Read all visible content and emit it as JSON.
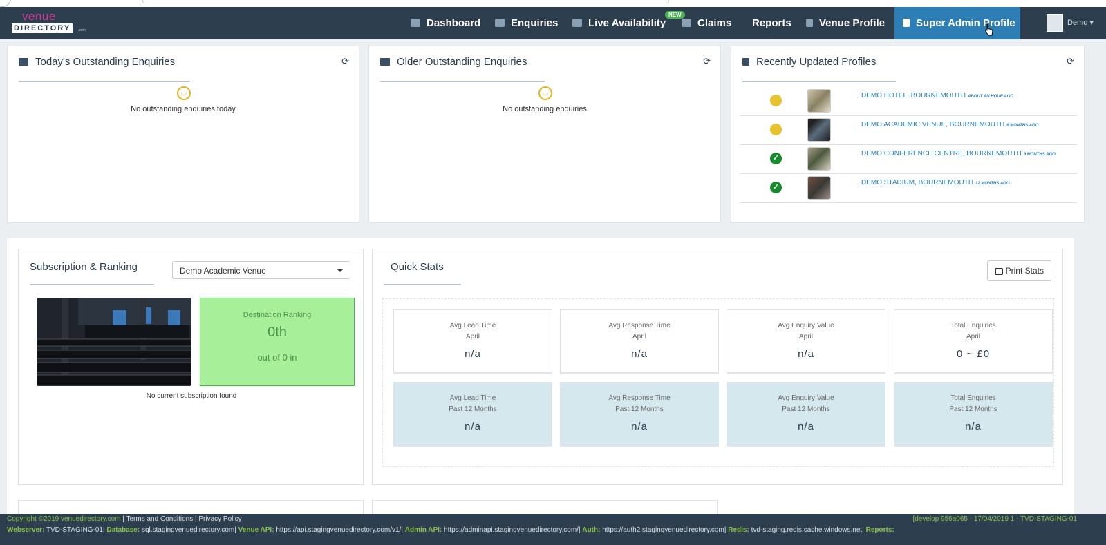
{
  "nav": {
    "logo_top": "venue",
    "logo_bottom": "DIRECTORY",
    "logo_com": ".com",
    "items": [
      {
        "label": "Dashboard",
        "icon": "dashboard-icon"
      },
      {
        "label": "Enquiries",
        "icon": "envelope-icon"
      },
      {
        "label": "Live Availability",
        "icon": "calendar-icon",
        "badge": "NEW"
      },
      {
        "label": "Claims",
        "icon": "book-icon"
      },
      {
        "label": "Reports",
        "icon": ""
      },
      {
        "label": "Venue Profile",
        "icon": "building-icon"
      },
      {
        "label": "Super Admin Profile",
        "icon": "lock-icon"
      }
    ],
    "user": "Demo",
    "user_caret": "▾"
  },
  "todays": {
    "title": "Today's Outstanding Enquiries",
    "empty": "No outstanding enquiries today"
  },
  "older": {
    "title": "Older Outstanding Enquiries",
    "empty": "No outstanding enquiries"
  },
  "recent": {
    "title": "Recently Updated Profiles",
    "profiles": [
      {
        "name": "DEMO HOTEL, BOURNEMOUTH",
        "time": "ABOUT AN HOUR AGO",
        "status": "pending"
      },
      {
        "name": "DEMO ACADEMIC VENUE, BOURNEMOUTH",
        "time": "6 MONTHS AGO",
        "status": "pending"
      },
      {
        "name": "DEMO CONFERENCE CENTRE, BOURNEMOUTH",
        "time": "9 MONTHS AGO",
        "status": "ok"
      },
      {
        "name": "DEMO STADIUM, BOURNEMOUTH",
        "time": "12 MONTHS AGO",
        "status": "ok"
      }
    ]
  },
  "subscription": {
    "title": "Subscription & Ranking",
    "selected_venue": "Demo Academic Venue",
    "rank_title": "Destination Ranking",
    "rank_value": "0th",
    "rank_sub": "out of 0 in",
    "no_sub": "No current subscription found"
  },
  "quick_stats": {
    "title": "Quick Stats",
    "print_label": "Print Stats",
    "cards": [
      {
        "label": "Avg Lead Time",
        "period": "April",
        "value": "n/a"
      },
      {
        "label": "Avg Response Time",
        "period": "April",
        "value": "n/a"
      },
      {
        "label": "Avg Enquiry Value",
        "period": "April",
        "value": "n/a"
      },
      {
        "label": "Total Enquiries",
        "period": "April",
        "value": "0 ~ £0"
      },
      {
        "label": "Avg Lead Time",
        "period": "Past 12 Months",
        "value": "n/a"
      },
      {
        "label": "Avg Response Time",
        "period": "Past 12 Months",
        "value": "n/a"
      },
      {
        "label": "Avg Enquiry Value",
        "period": "Past 12 Months",
        "value": "n/a"
      },
      {
        "label": "Total Enquiries",
        "period": "Past 12 Months",
        "value": "n/a"
      }
    ]
  },
  "footer": {
    "copyright": "Copyright ©2019 venuedirectory.com",
    "terms": "Terms and Conditions",
    "privacy": "Privacy Policy",
    "build": "[develop 956a065 - 17/04/2019 1 - TVD-STAGING-01",
    "webserver_label": "Webserver:",
    "webserver": "TVD-STAGING-01",
    "database_label": "Database:",
    "database": "sql.stagingvenuedirectory.com",
    "venue_api_label": "Venue API:",
    "venue_api": "https://api.stagingvenuedirectory.com/v1/",
    "admin_api_label": "Admin API:",
    "admin_api": "https://adminapi.stagingvenuedirectory.com/",
    "auth_label": "Auth:",
    "auth": "https://auth2.stagingvenuedirectory.com",
    "redis_label": "Redis:",
    "redis": "tvd-staging.redis.cache.windows.net",
    "reports_label": "Reports:"
  }
}
